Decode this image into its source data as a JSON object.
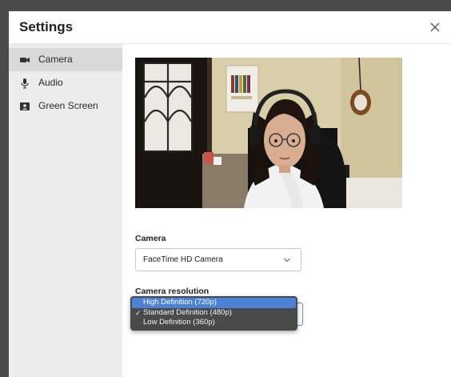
{
  "dialog": {
    "title": "Settings",
    "close_icon": "close-icon"
  },
  "sidebar": {
    "items": [
      {
        "label": "Camera",
        "icon": "camera-icon",
        "active": true
      },
      {
        "label": "Audio",
        "icon": "microphone-icon",
        "active": false
      },
      {
        "label": "Green Screen",
        "icon": "green-screen-icon",
        "active": false
      }
    ]
  },
  "camera": {
    "label": "Camera",
    "selected": "FaceTime HD Camera"
  },
  "resolution": {
    "label": "Camera resolution",
    "options": [
      {
        "label": "High Definition (720p)",
        "highlighted": true,
        "checked": false
      },
      {
        "label": "Standard Definition (480p)",
        "highlighted": false,
        "checked": true
      },
      {
        "label": "Low Definition (360p)",
        "highlighted": false,
        "checked": false
      }
    ]
  },
  "colors": {
    "accent": "#4b82d8",
    "sidebar_bg": "#ececec",
    "sidebar_active": "#d9d9d9",
    "dropdown_bg": "#4a4a4a"
  }
}
